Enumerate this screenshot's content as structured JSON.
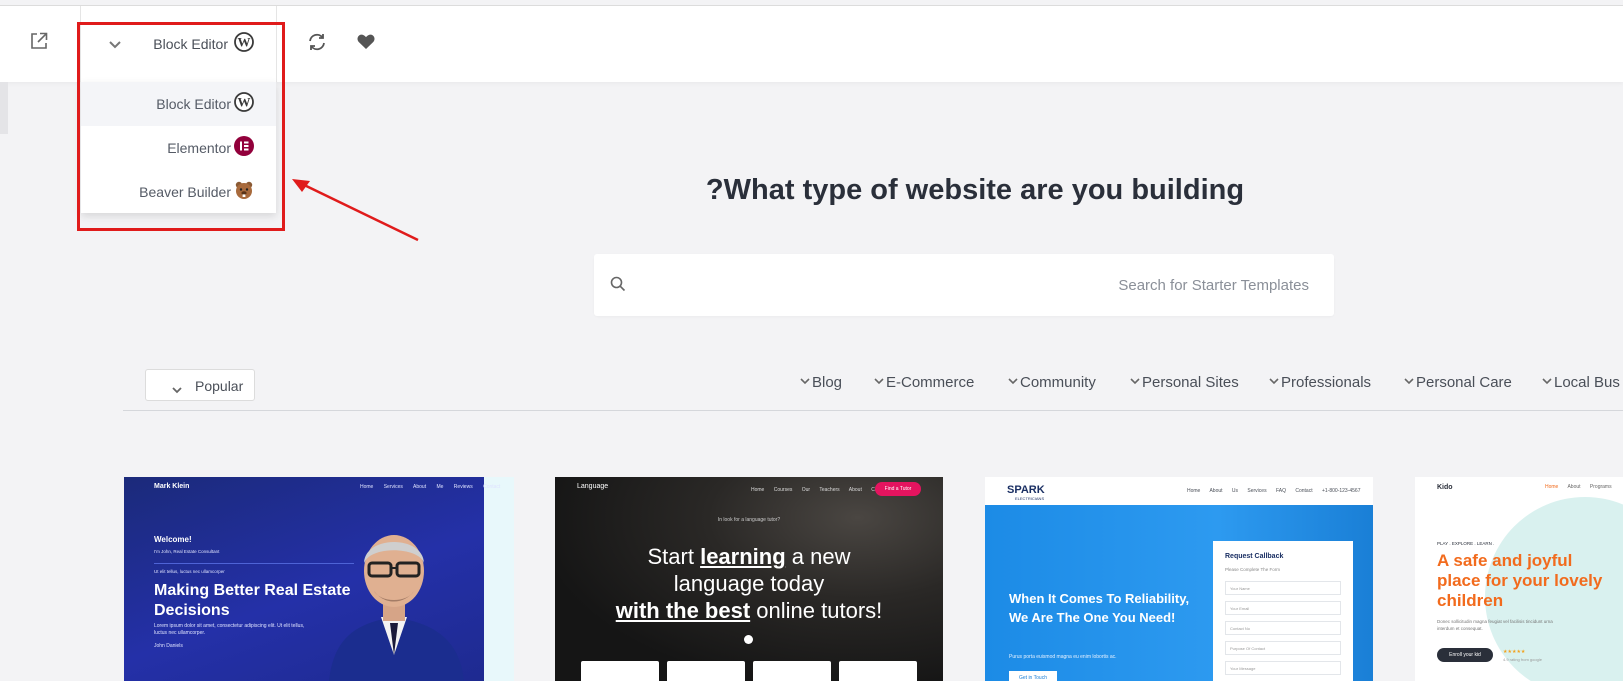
{
  "toolbar": {
    "builder_selected": "Block Editor"
  },
  "builder_menu": {
    "items": [
      {
        "label": "Block Editor",
        "icon": "wordpress-icon"
      },
      {
        "label": "Elementor",
        "icon": "elementor-icon"
      },
      {
        "label": "Beaver Builder",
        "icon": "beaver-icon"
      }
    ]
  },
  "main": {
    "title": "?What type of website are you building",
    "search_placeholder": "Search for Starter Templates"
  },
  "filters": {
    "sort_label": "Popular",
    "categories": [
      "Blog",
      "E-Commerce",
      "Community",
      "Personal Sites",
      "Professionals",
      "Personal Care",
      "Local Bus"
    ]
  },
  "templates": [
    {
      "logo": "Mark Klein",
      "nav": "Home Services About Me Reviews Contact",
      "welcome": "Welcome!",
      "sub": "I'm John, Real Estate Consultant",
      "sub2": "Ut elit tellus, luctus nec ullamcorper",
      "headline": "Making Better Real Estate Decisions",
      "desc": "Lorem ipsum dolor sit amet, consectetur adipiscing elit. Ut elit tellus, luctus nec ullamcorper.",
      "signature": "John Daniels"
    },
    {
      "logo": "Language",
      "nav": "Home Courses Our Teachers About Contact",
      "cta": "Find a Tutor",
      "kicker": "In look for a language tutor?",
      "line1_pre": "Start",
      "line1_emph": "learning",
      "line1_post": "a new",
      "line2": "language today",
      "line3_emph": "with the best",
      "line3_post": "online tutors!"
    },
    {
      "logo": "SPARK",
      "logo_sub": "ELECTRICIANS",
      "nav": "Home About Us Services FAQ Contact +1-800-123-4567",
      "headline": "When It Comes To Reliability, We Are The One You Need!",
      "desc": "Purus porta euismod magna eu enim lobortis ac.",
      "button": "Get in Touch",
      "form_title": "Request Callback",
      "form_sub": "Please Complete The Form",
      "fields": [
        "Your Name",
        "Your Email",
        "Contact No",
        "Purpose Of Contact",
        "Your Message"
      ]
    },
    {
      "logo": "Kido",
      "nav_home": "Home",
      "nav_rest": "About Programs",
      "kicker": "PLAY . EXPLORE . LEARN .",
      "headline": "A safe and joyful place for your lovely children",
      "desc": "Donec sollicitudin magna feugiat vel facilisis tincidunt urna interdum et consequat.",
      "button": "Enroll your kid",
      "stars": "★★★★★",
      "stars_sub": "4.9 rating from google"
    }
  ]
}
